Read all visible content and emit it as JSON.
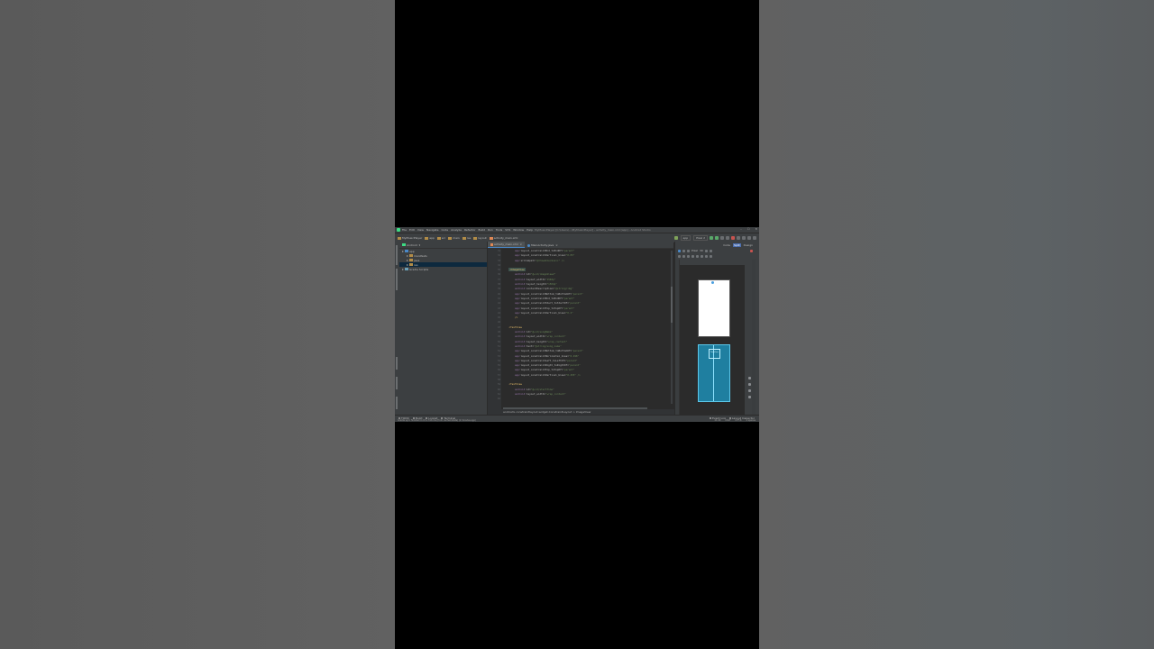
{
  "window": {
    "title": "MyMusicPlayer [C:\\Users\\...\\MyMusicPlayer] - activity_main.xml [app] - Android Studio",
    "controls": [
      "–",
      "☐",
      "✕"
    ]
  },
  "menu": [
    "File",
    "Edit",
    "View",
    "Navigate",
    "Code",
    "Analyze",
    "Refactor",
    "Build",
    "Run",
    "Tools",
    "VCS",
    "Window",
    "Help"
  ],
  "breadcrumbs": [
    "MyMusicPlayer",
    "app",
    "src",
    "main",
    "res",
    "layout",
    "activity_main.xml"
  ],
  "run_config": {
    "module": "app",
    "device": "Pixel 2"
  },
  "project_panel": {
    "view_selector": "Android",
    "tree": [
      {
        "label": "app",
        "level": 0,
        "selected": false
      },
      {
        "label": "manifests",
        "level": 1,
        "selected": false
      },
      {
        "label": "java",
        "level": 1,
        "selected": false
      },
      {
        "label": "res",
        "level": 1,
        "selected": true
      },
      {
        "label": "Gradle Scripts",
        "level": 0,
        "selected": false
      }
    ]
  },
  "editor": {
    "tabs": [
      {
        "label": "activity_main.xml",
        "active": true
      },
      {
        "label": "MainActivity.java",
        "active": false
      }
    ],
    "line_numbers": [
      "31",
      "32",
      "33",
      "34",
      "35",
      "36",
      "37",
      "38",
      "39",
      "40",
      "41",
      "42",
      "43",
      "44",
      "45",
      "46",
      "47",
      "48",
      "49",
      "50",
      "51",
      "52",
      "53",
      "54",
      "55",
      "56",
      "57",
      "58",
      "59",
      "60",
      "61",
      "62"
    ],
    "breadcrumb": "androidx.constraintlayout.widget.ConstraintLayout  >  ImageView"
  },
  "code_lines": [
    {
      "indent": "        ",
      "ns": "app:",
      "attr": "layout_constraintEnd_toEndOf=",
      "val": "\"parent\""
    },
    {
      "indent": "        ",
      "ns": "app:",
      "attr": "layout_constraintVertical_bias=",
      "val": "\"0.05\""
    },
    {
      "indent": "        ",
      "ns": "app:",
      "attr": "srcCompat=",
      "val": "\"@drawable/music\" />"
    },
    {
      "indent": "",
      "ns": "",
      "attr": "",
      "val": ""
    },
    {
      "indent": "    ",
      "tag": "<ImageView",
      "hl": true
    },
    {
      "indent": "        ",
      "ns": "android:",
      "attr": "id=",
      "val": "\"@+id/imageView2\""
    },
    {
      "indent": "        ",
      "ns": "android:",
      "attr": "layout_width=",
      "val": "\"150dp\""
    },
    {
      "indent": "        ",
      "ns": "android:",
      "attr": "layout_height=",
      "val": "\"150dp\""
    },
    {
      "indent": "        ",
      "ns": "android:",
      "attr": "contentDescription=",
      "val": "\"@string/img\""
    },
    {
      "indent": "        ",
      "ns": "app:",
      "attr": "layout_constraintBottom_toBottomOf=",
      "val": "\"parent\""
    },
    {
      "indent": "        ",
      "ns": "app:",
      "attr": "layout_constraintEnd_toEndOf=",
      "val": "\"parent\""
    },
    {
      "indent": "        ",
      "ns": "app:",
      "attr": "layout_constraintStart_toStartOf=",
      "val": "\"parent\""
    },
    {
      "indent": "        ",
      "ns": "app:",
      "attr": "layout_constraintTop_toTopOf=",
      "val": "\"parent\""
    },
    {
      "indent": "        ",
      "ns": "app:",
      "attr": "layout_constraintVertical_bias=",
      "val": "\"0.2\""
    },
    {
      "indent": "        ",
      "tag": "/>"
    },
    {
      "indent": "",
      "ns": "",
      "attr": "",
      "val": ""
    },
    {
      "indent": "    ",
      "tag": "<TextView"
    },
    {
      "indent": "        ",
      "ns": "android:",
      "attr": "id=",
      "val": "\"@+id/songName\""
    },
    {
      "indent": "        ",
      "ns": "android:",
      "attr": "layout_width=",
      "val": "\"wrap_content\""
    },
    {
      "indent": "        ",
      "ns": "android:",
      "attr": "layout_height=",
      "val": "\"wrap_content\""
    },
    {
      "indent": "        ",
      "ns": "android:",
      "attr": "text=",
      "val": "\"@string/song_name\""
    },
    {
      "indent": "        ",
      "ns": "app:",
      "attr": "layout_constraintBottom_toBottomOf=",
      "val": "\"parent\""
    },
    {
      "indent": "        ",
      "ns": "app:",
      "attr": "layout_constraintHorizontal_bias=",
      "val": "\"0.498\""
    },
    {
      "indent": "        ",
      "ns": "app:",
      "attr": "layout_constraintLeft_toLeftOf=",
      "val": "\"parent\""
    },
    {
      "indent": "        ",
      "ns": "app:",
      "attr": "layout_constraintRight_toRightOf=",
      "val": "\"parent\""
    },
    {
      "indent": "        ",
      "ns": "app:",
      "attr": "layout_constraintTop_toTopOf=",
      "val": "\"parent\""
    },
    {
      "indent": "        ",
      "ns": "app:",
      "attr": "layout_constraintVertical_bias=",
      "val": "\"0.455\" />"
    },
    {
      "indent": "",
      "ns": "",
      "attr": "",
      "val": ""
    },
    {
      "indent": "    ",
      "tag": "<TextView"
    },
    {
      "indent": "        ",
      "ns": "android:",
      "attr": "id=",
      "val": "\"@+id/startTime\""
    },
    {
      "indent": "        ",
      "ns": "android:",
      "attr": "layout_width=",
      "val": "\"wrap_content\""
    }
  ],
  "design": {
    "modes": [
      "Code",
      "Split",
      "Design"
    ],
    "active_mode": "Split",
    "device_label": "Pixel",
    "api_label": "30",
    "blueprint_label": "TextView"
  },
  "bottom_tools": [
    "TODO",
    "Build",
    "Logcat",
    "Terminal"
  ],
  "bottom_tools_right": [
    "Event Log",
    "Layout Inspector"
  ],
  "status": {
    "message": "Gradle sync finished in 15 s 316 ms (from cached state) (2 minutes ago)",
    "cursor": "21:29",
    "line_sep": "CRLF",
    "encoding": "UTF-8",
    "indent": "4 spaces"
  },
  "colors": {
    "ide_background": "#2b2b2b",
    "panel": "#3c3f41",
    "accent": "#4a88c7",
    "blueprint": "#1f7fa0",
    "xml_tag": "#e8bf6a",
    "xml_value": "#6a8759"
  }
}
